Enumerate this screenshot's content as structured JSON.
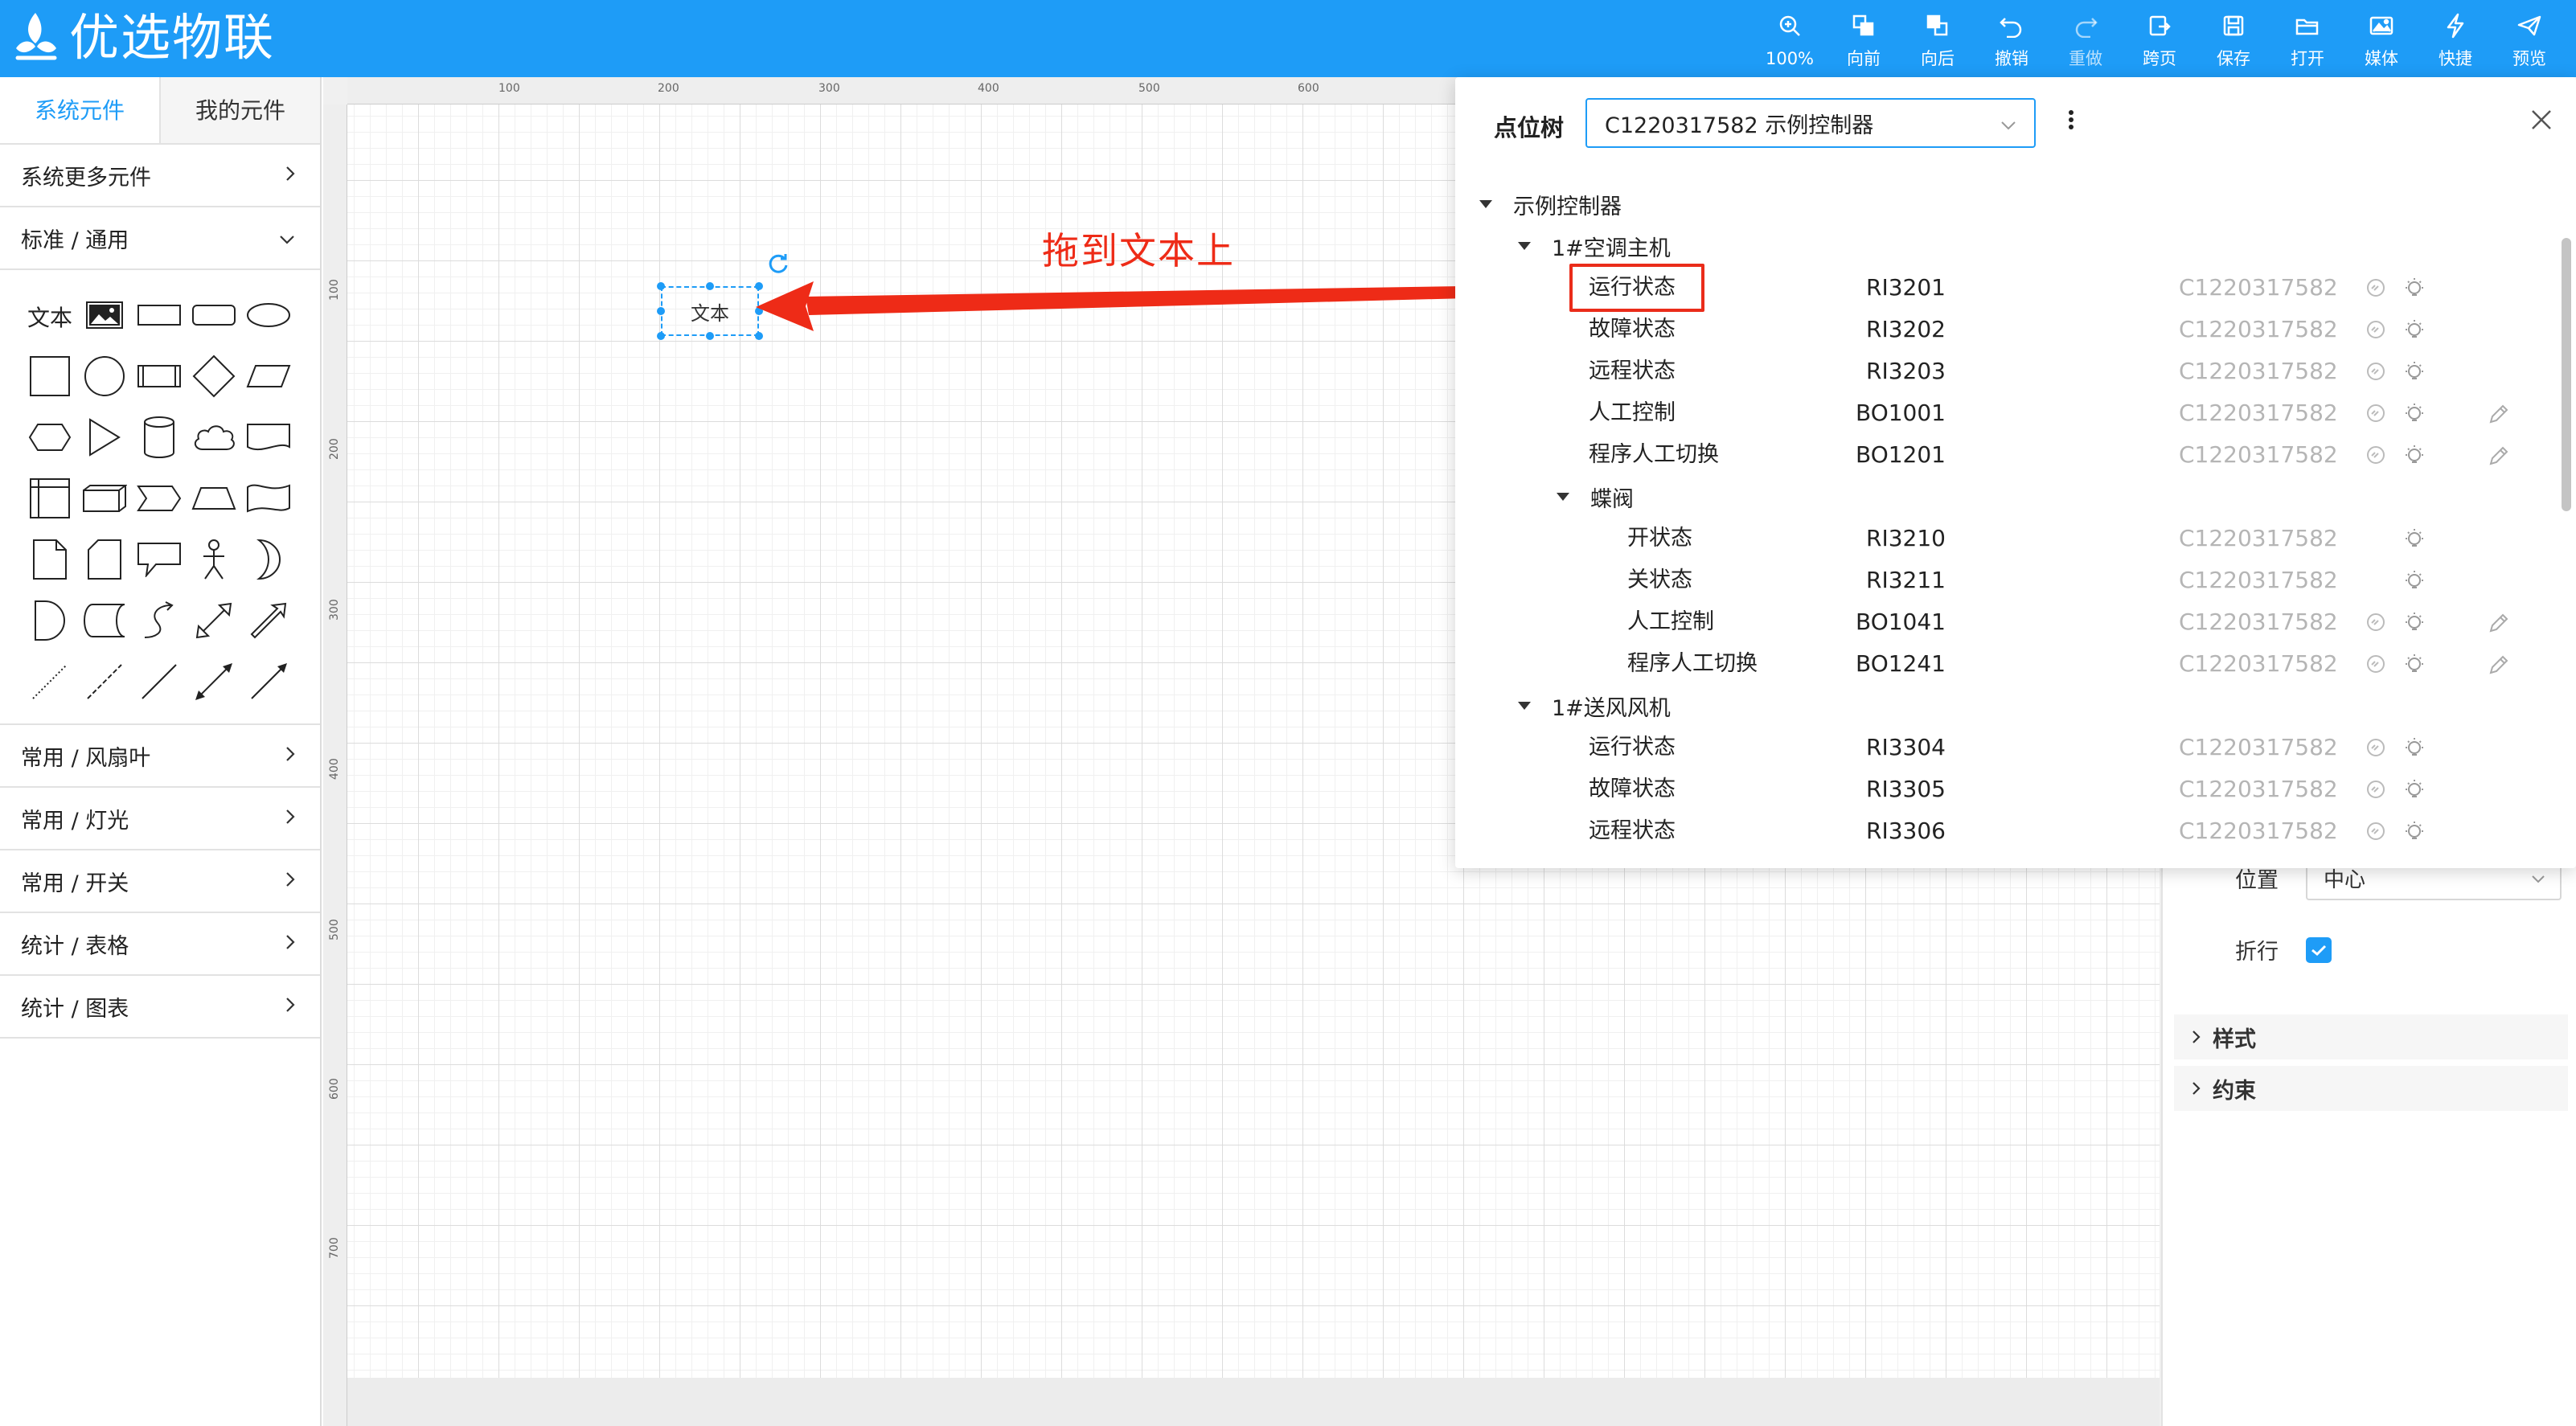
{
  "app": {
    "title": "优选物联",
    "accent": "#1e9cf7"
  },
  "toolbar": [
    {
      "icon": "zoom-in-icon",
      "label": "100%"
    },
    {
      "icon": "bring-forward-icon",
      "label": "向前"
    },
    {
      "icon": "send-backward-icon",
      "label": "向后"
    },
    {
      "icon": "undo-icon",
      "label": "撤销"
    },
    {
      "icon": "redo-icon",
      "label": "重做"
    },
    {
      "icon": "cross-page-icon",
      "label": "跨页"
    },
    {
      "icon": "save-icon",
      "label": "保存"
    },
    {
      "icon": "open-folder-icon",
      "label": "打开"
    },
    {
      "icon": "media-icon",
      "label": "媒体"
    },
    {
      "icon": "lightning-icon",
      "label": "快捷"
    },
    {
      "icon": "preview-icon",
      "label": "预览"
    }
  ],
  "left": {
    "tabs": [
      "系统元件",
      "我的元件"
    ],
    "more": "系统更多元件",
    "standard": "标准 / 通用",
    "text_shape": "文本",
    "categories": [
      "常用 / 风扇叶",
      "常用 / 灯光",
      "常用 / 开关",
      "统计 / 表格",
      "统计 / 图表"
    ]
  },
  "ruler": {
    "top": [
      "100",
      "200",
      "300",
      "400",
      "500",
      "600"
    ],
    "left": [
      "100",
      "200",
      "300",
      "400",
      "500",
      "600",
      "700"
    ]
  },
  "canvas": {
    "selected_text": "文本",
    "annotation": "拖到文本上",
    "annotation_color": "#ee2b17"
  },
  "properties": {
    "position_label": "位置",
    "position_value": "中心",
    "wrap_label": "折行",
    "sections": [
      "样式",
      "约束"
    ]
  },
  "popup": {
    "title": "点位树",
    "selected_controller": "C1220317582 示例控制器",
    "tree": [
      {
        "type": "group",
        "level": 0,
        "label": "示例控制器"
      },
      {
        "type": "group",
        "level": 1,
        "label": "1#空调主机"
      },
      {
        "type": "leaf",
        "level": 2,
        "name": "运行状态",
        "code": "RI3201",
        "id": "C1220317582",
        "icons": [
          "link-icon",
          "bulb-icon"
        ]
      },
      {
        "type": "leaf",
        "level": 2,
        "name": "故障状态",
        "code": "RI3202",
        "id": "C1220317582",
        "icons": [
          "link-icon",
          "bulb-icon"
        ]
      },
      {
        "type": "leaf",
        "level": 2,
        "name": "远程状态",
        "code": "RI3203",
        "id": "C1220317582",
        "icons": [
          "link-icon",
          "bulb-icon"
        ]
      },
      {
        "type": "leaf",
        "level": 2,
        "name": "人工控制",
        "code": "BO1001",
        "id": "C1220317582",
        "icons": [
          "link-icon",
          "bulb-icon",
          "edit-icon"
        ]
      },
      {
        "type": "leaf",
        "level": 2,
        "name": "程序人工切换",
        "code": "BO1201",
        "id": "C1220317582",
        "icons": [
          "link-icon",
          "bulb-icon",
          "edit-icon"
        ]
      },
      {
        "type": "group",
        "level": 2,
        "label": "蝶阀"
      },
      {
        "type": "leaf",
        "level": 3,
        "name": "开状态",
        "code": "RI3210",
        "id": "C1220317582",
        "icons": [
          "bulb-icon"
        ]
      },
      {
        "type": "leaf",
        "level": 3,
        "name": "关状态",
        "code": "RI3211",
        "id": "C1220317582",
        "icons": [
          "bulb-icon"
        ]
      },
      {
        "type": "leaf",
        "level": 3,
        "name": "人工控制",
        "code": "BO1041",
        "id": "C1220317582",
        "icons": [
          "link-icon",
          "bulb-icon",
          "edit-icon"
        ]
      },
      {
        "type": "leaf",
        "level": 3,
        "name": "程序人工切换",
        "code": "BO1241",
        "id": "C1220317582",
        "icons": [
          "link-icon",
          "bulb-icon",
          "edit-icon"
        ]
      },
      {
        "type": "group",
        "level": 1,
        "label": "1#送风风机"
      },
      {
        "type": "leaf",
        "level": 2,
        "name": "运行状态",
        "code": "RI3304",
        "id": "C1220317582",
        "icons": [
          "link-icon",
          "bulb-icon"
        ]
      },
      {
        "type": "leaf",
        "level": 2,
        "name": "故障状态",
        "code": "RI3305",
        "id": "C1220317582",
        "icons": [
          "link-icon",
          "bulb-icon"
        ]
      },
      {
        "type": "leaf",
        "level": 2,
        "name": "远程状态",
        "code": "RI3306",
        "id": "C1220317582",
        "icons": [
          "link-icon",
          "bulb-icon"
        ]
      }
    ]
  }
}
